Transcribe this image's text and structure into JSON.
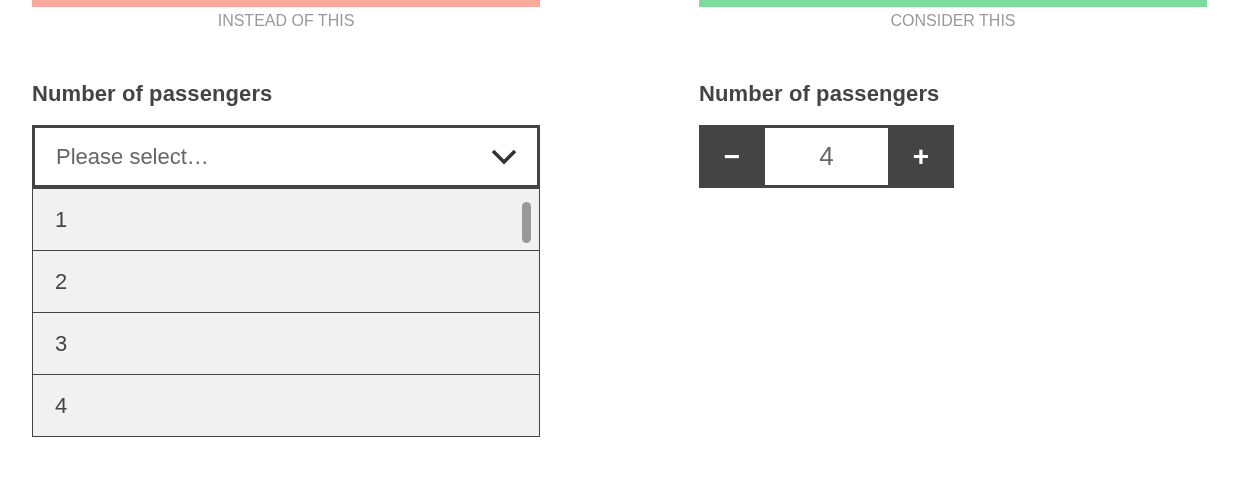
{
  "panels": [
    {
      "caption": "INSTEAD OF THIS",
      "color": "#f8aa9c",
      "kind": "dropdown",
      "label": "Number of passengers",
      "placeholder": "Please select…",
      "options": [
        "1",
        "2",
        "3",
        "4"
      ]
    },
    {
      "caption": "CONSIDER THIS",
      "color": "#7ddb9d",
      "kind": "stepper",
      "label": "Number of passengers",
      "decrement": "−",
      "value": "4",
      "increment": "+"
    }
  ]
}
